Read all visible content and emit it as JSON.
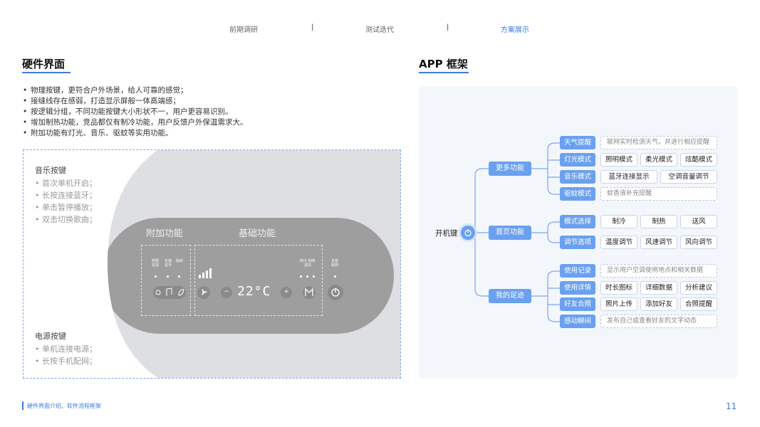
{
  "nav": {
    "items": [
      "前期调研",
      "测试迭代",
      "方案展示"
    ],
    "separator": "|",
    "active_color": "#3a7be0"
  },
  "hardware": {
    "title": "硬件界面",
    "bullets": [
      "物理按键，更符合户外场景，给人可靠的感觉；",
      "接缝线存在感弱，打造显示屏般一体高端感；",
      "按逻辑分组，不同功能按键大小形状不一，用户更容易识别。",
      "增加制热功能，竞品都仅有制冷功能，用户反馈户外保温需求大。",
      "附加功能有灯光、音乐、驱蚊等实用功能。"
    ],
    "music_group": {
      "title": "音乐按键",
      "items": [
        "首次单机开启；",
        "长按连接蓝牙；",
        "单击暂停播放；",
        "双击切换歌曲；"
      ]
    },
    "power_group": {
      "title": "电源按键",
      "items": [
        "单机连接电源；",
        "长按手机配网；"
      ]
    },
    "device": {
      "extra_label": "附加功能",
      "basic_label": "基础功能",
      "temperature": "22°C",
      "minus": "−",
      "plus": "+",
      "small_labels": {
        "light": "照明",
        "light2": "氛围",
        "music": "长按",
        "music2": "蓝牙",
        "mosquito": "驱蚊",
        "cool": "制冷",
        "heat": "制热",
        "fan": "送风",
        "network": "长按",
        "network2": "配网"
      }
    }
  },
  "app": {
    "title": "APP 框架",
    "root": "开机键",
    "branches": [
      {
        "name": "更多功能",
        "children": [
          {
            "name": "天气提醒",
            "leaves": [
              "联网实时检测天气，并进行相应提醒"
            ],
            "dashed": true
          },
          {
            "name": "灯光模式",
            "leaves": [
              "照明模式",
              "柔光模式",
              "炫酷模式"
            ],
            "dashed": false
          },
          {
            "name": "音乐模式",
            "leaves": [
              "蓝牙连接显示",
              "空调音量调节"
            ],
            "dashed": false
          },
          {
            "name": "驱蚊模式",
            "leaves": [
              "蚊香液补充提醒"
            ],
            "dashed": true
          }
        ]
      },
      {
        "name": "首页功能",
        "children": [
          {
            "name": "模式选择",
            "leaves": [
              "制冷",
              "制热",
              "送风"
            ],
            "dashed": false
          },
          {
            "name": "调节选项",
            "leaves": [
              "温度调节",
              "风速调节",
              "风向调节"
            ],
            "dashed": false
          }
        ]
      },
      {
        "name": "我的足迹",
        "children": [
          {
            "name": "使用记录",
            "leaves": [
              "显示用户空调使用地点和相关数据"
            ],
            "dashed": true
          },
          {
            "name": "使用详情",
            "leaves": [
              "时长图标",
              "详细数据",
              "分析建议"
            ],
            "dashed": false
          },
          {
            "name": "好友合照",
            "leaves": [
              "照片上传",
              "添加好友",
              "合照提醒"
            ],
            "dashed": false
          },
          {
            "name": "感动瞬间",
            "leaves": [
              "发布自己或查看好友的文字动态"
            ],
            "dashed": true
          }
        ]
      }
    ]
  },
  "footer": {
    "text": "硬件界面介绍、软件流程框架",
    "page": "11"
  }
}
